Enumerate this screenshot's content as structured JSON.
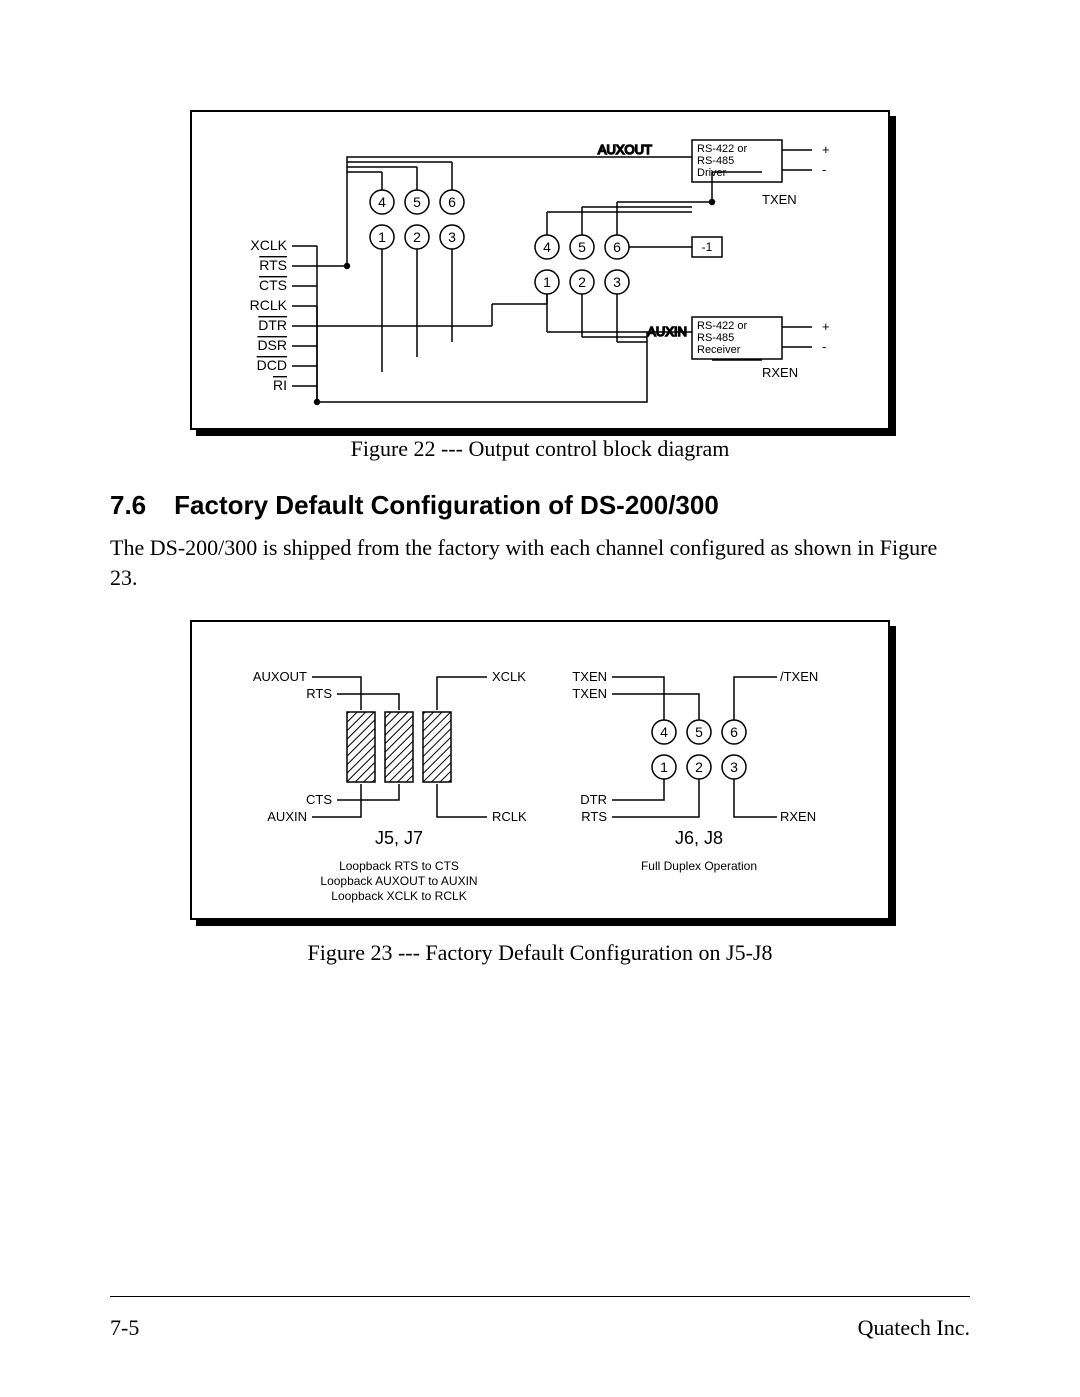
{
  "figure22": {
    "caption": "Figure 22 --- Output control block diagram",
    "signals_left": [
      "XCLK",
      "RTS",
      "CTS",
      "RCLK",
      "DTR",
      "DSR",
      "DCD",
      "RI"
    ],
    "overline_map": {
      "RTS": true,
      "CTS": true,
      "DTR": true,
      "DSR": true,
      "DCD": true,
      "RI": true
    },
    "pins_top": [
      "4",
      "5",
      "6"
    ],
    "pins_bottom": [
      "1",
      "2",
      "3"
    ],
    "auxout": "AUXOUT",
    "auxin": "AUXIN",
    "txen": "TXEN",
    "rxen": "RXEN",
    "minus1": "-1",
    "driver_label1": "RS-422 or",
    "driver_label2": "RS-485",
    "driver_label3": "Driver",
    "driver_label4": "Receiver",
    "plus": "+",
    "minus": "-"
  },
  "section": {
    "number": "7.6",
    "title": "Factory Default Configuration of DS-200/300",
    "paragraph": "The DS-200/300 is shipped from the factory with each channel configured as shown in Figure 23."
  },
  "figure23": {
    "caption": "Figure 23 --- Factory Default Configuration on J5-J8",
    "left": {
      "auxout": "AUXOUT",
      "rts": "RTS",
      "cts": "CTS",
      "auxin": "AUXIN",
      "xclk": "XCLK",
      "rclk": "RCLK",
      "jumper": "J5, J7",
      "note1": "Loopback RTS to CTS",
      "note2": "Loopback AUXOUT to AUXIN",
      "note3": "Loopback XCLK to RCLK"
    },
    "right": {
      "txen": "TXEN",
      "txen2": "TXEN",
      "slash_txen": "/TXEN",
      "dtr": "DTR",
      "rts": "RTS",
      "rxen": "RXEN",
      "pins_top": [
        "4",
        "5",
        "6"
      ],
      "pins_bottom": [
        "1",
        "2",
        "3"
      ],
      "jumper": "J6, J8",
      "note": "Full Duplex Operation"
    }
  },
  "footer": {
    "page": "7-5",
    "company": "Quatech Inc."
  }
}
